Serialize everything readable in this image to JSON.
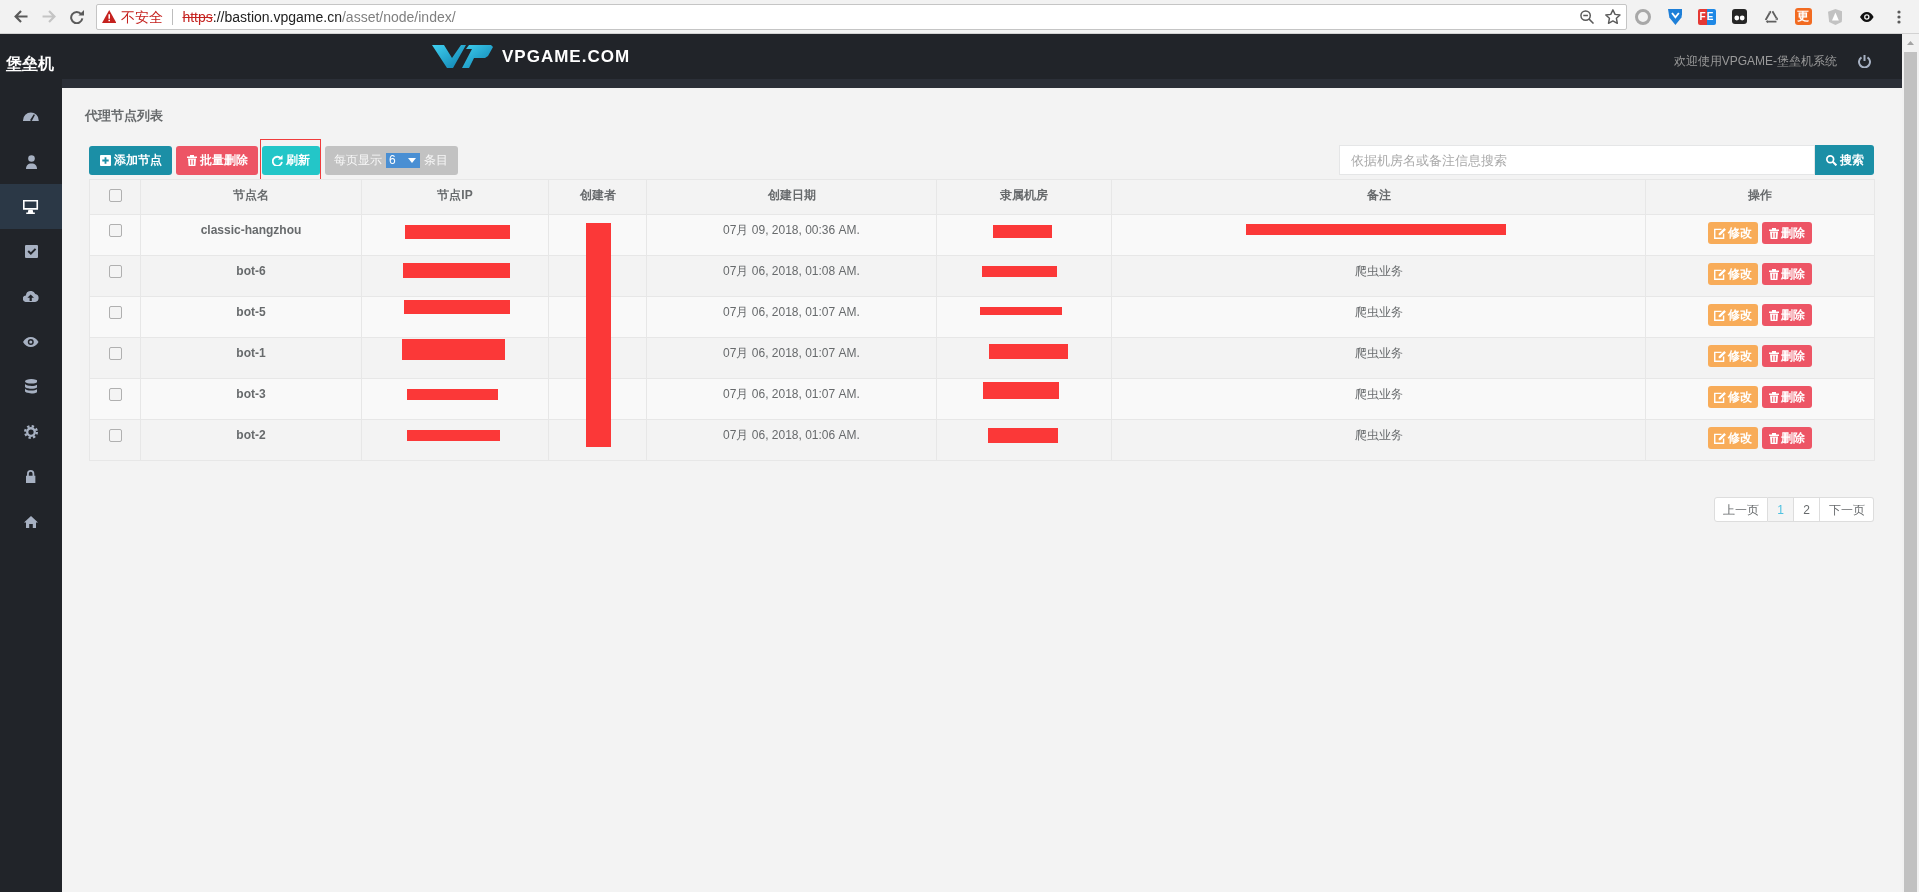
{
  "browser": {
    "security_label": "不安全",
    "url": {
      "scheme": "https",
      "host": "://bastion.vpgame.cn",
      "path": "/asset/node/index/"
    },
    "extensions": [
      {
        "kind": "ring"
      },
      {
        "kind": "shield"
      },
      {
        "kind": "badge",
        "text": "FE"
      },
      {
        "kind": "mask"
      },
      {
        "kind": "recycle"
      },
      {
        "kind": "tile",
        "text": "更"
      },
      {
        "kind": "angular"
      },
      {
        "kind": "eye"
      }
    ]
  },
  "header": {
    "brand": "堡垒机",
    "logo_text": "VPGAME.COM",
    "welcome": "欢迎使用VPGAME-堡垒机系统"
  },
  "sidebar": {
    "items": [
      {
        "kind": "dashboard",
        "selected": false
      },
      {
        "kind": "user",
        "selected": false
      },
      {
        "kind": "desktop",
        "selected": true
      },
      {
        "kind": "tasks",
        "selected": false
      },
      {
        "kind": "upload",
        "selected": false
      },
      {
        "kind": "eye",
        "selected": false
      },
      {
        "kind": "database",
        "selected": false
      },
      {
        "kind": "settings",
        "selected": false
      },
      {
        "kind": "lock",
        "selected": false
      },
      {
        "kind": "home",
        "selected": false
      }
    ]
  },
  "page": {
    "title": "代理节点列表"
  },
  "toolbar": {
    "buttons": [
      {
        "kind": "add",
        "label": "添加节点",
        "highlighted": false
      },
      {
        "kind": "delete",
        "label": "批量删除",
        "highlighted": false
      },
      {
        "kind": "refresh",
        "label": "刷新",
        "highlighted": true
      }
    ],
    "page_size": {
      "prefix": "每页显示",
      "value": "6",
      "suffix": "条目"
    },
    "search": {
      "placeholder": "依据机房名或备注信息搜索",
      "button": "搜索"
    }
  },
  "table": {
    "select_all_checked": false,
    "columns": [
      "节点名",
      "节点IP",
      "创建者",
      "创建日期",
      "隶属机房",
      "备注",
      "操作"
    ],
    "creator_redacted": true,
    "rows": [
      {
        "checked": false,
        "name": "classic-hangzhou",
        "ip_redacted": true,
        "date": "07月 09, 2018, 00:36 AM.",
        "room_redacted": true,
        "note_redacted": true,
        "actions": [
          {
            "kind": "edit",
            "label": "修改"
          },
          {
            "kind": "delete",
            "label": "删除"
          }
        ]
      },
      {
        "checked": false,
        "name": "bot-6",
        "ip_redacted": true,
        "date": "07月 06, 2018, 01:08 AM.",
        "room_redacted": true,
        "note": "爬虫业务",
        "actions": [
          {
            "kind": "edit",
            "label": "修改"
          },
          {
            "kind": "delete",
            "label": "删除"
          }
        ]
      },
      {
        "checked": false,
        "name": "bot-5",
        "ip_redacted": true,
        "date": "07月 06, 2018, 01:07 AM.",
        "room_redacted": true,
        "note": "爬虫业务",
        "actions": [
          {
            "kind": "edit",
            "label": "修改"
          },
          {
            "kind": "delete",
            "label": "删除"
          }
        ]
      },
      {
        "checked": false,
        "name": "bot-1",
        "ip_redacted": true,
        "date": "07月 06, 2018, 01:07 AM.",
        "room_redacted": true,
        "note": "爬虫业务",
        "actions": [
          {
            "kind": "edit",
            "label": "修改"
          },
          {
            "kind": "delete",
            "label": "删除"
          }
        ]
      },
      {
        "checked": false,
        "name": "bot-3",
        "ip_redacted": true,
        "date": "07月 06, 2018, 01:07 AM.",
        "room_redacted": true,
        "note": "爬虫业务",
        "actions": [
          {
            "kind": "edit",
            "label": "修改"
          },
          {
            "kind": "delete",
            "label": "删除"
          }
        ]
      },
      {
        "checked": false,
        "name": "bot-2",
        "ip_redacted": true,
        "date": "07月 06, 2018, 01:06 AM.",
        "room_redacted": true,
        "note": "爬虫业务",
        "actions": [
          {
            "kind": "edit",
            "label": "修改"
          },
          {
            "kind": "delete",
            "label": "删除"
          }
        ]
      }
    ]
  },
  "pagination": {
    "prev": "上一页",
    "pages": [
      {
        "label": "1",
        "selected": true
      },
      {
        "label": "2",
        "selected": false
      }
    ],
    "next": "下一页"
  }
}
